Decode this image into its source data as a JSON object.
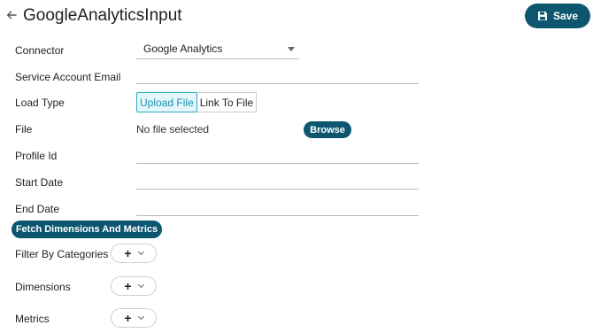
{
  "header": {
    "title": "GoogleAnalyticsInput",
    "back_icon": "arrow-left-icon",
    "save_label": "Save",
    "save_icon": "floppy-disk-icon"
  },
  "form": {
    "connector": {
      "label": "Connector",
      "value": "Google Analytics"
    },
    "service_account_email": {
      "label": "Service Account Email",
      "value": ""
    },
    "load_type": {
      "label": "Load Type",
      "options": [
        "Upload File",
        "Link To File"
      ],
      "selected": "Upload File"
    },
    "file": {
      "label": "File",
      "status": "No file selected",
      "browse_label": "Browse"
    },
    "profile_id": {
      "label": "Profile Id",
      "value": ""
    },
    "start_date": {
      "label": "Start Date",
      "value": ""
    },
    "end_date": {
      "label": "End Date",
      "value": ""
    },
    "fetch_label": "Fetch Dimensions And Metrics",
    "filter_by_categories": {
      "label": "Filter By Categories",
      "add_symbol": "+"
    },
    "dimensions": {
      "label": "Dimensions",
      "add_symbol": "+"
    },
    "metrics": {
      "label": "Metrics",
      "add_symbol": "+"
    }
  },
  "colors": {
    "primary_button": "#0d5670",
    "active_segment": "#2ea9c4"
  }
}
